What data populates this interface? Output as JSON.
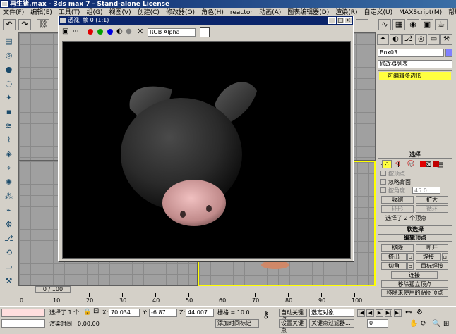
{
  "app": {
    "title": "再生猪.max - 3ds max 7 - Stand-alone License"
  },
  "menu": [
    "文件(F)",
    "编辑(E)",
    "工具(T)",
    "组(G)",
    "视图(V)",
    "创建(C)",
    "修改器(O)",
    "角色(H)",
    "reactor",
    "动画(A)",
    "图表编辑器(D)",
    "渲染(R)",
    "自定义(U)",
    "MAXScript(M)",
    "帮助(H)"
  ],
  "render_window": {
    "title": "透视, 帧 0 (1:1)",
    "channel": "RGB Alpha",
    "colors": {
      "red": "#e00000",
      "green": "#00a000",
      "blue": "#0000e0"
    }
  },
  "command_panel": {
    "object_name": "Box03",
    "modifier_list": "修改器列表",
    "stack_item": "可编辑多边形",
    "rollouts": {
      "selection": "选择",
      "by_vertex": "按顶点",
      "ignore_backfacing": "忽略背面",
      "by_angle": "按角度:",
      "angle_value": "45.0",
      "shrink": "收缩",
      "grow": "扩大",
      "ring": "环形",
      "loop": "循环",
      "selected_info": "选择了 2 个顶点",
      "soft_selection": "软选择",
      "edit_vertices": "编辑顶点",
      "remove": "移除",
      "break": "断开",
      "extrude": "挤出",
      "weld": "焊接",
      "chamfer": "切角",
      "target_weld": "目标焊接",
      "connect": "连接",
      "remove_isolated": "移除孤立顶点",
      "remove_unused": "移除未使用的贴图顶点"
    }
  },
  "timeline": {
    "frame": "0 / 100",
    "ticks": [
      "0",
      "10",
      "20",
      "30",
      "40",
      "50",
      "60",
      "70",
      "80",
      "90",
      "100"
    ]
  },
  "status": {
    "selected": "选择了 1 个",
    "x_label": "X:",
    "x_value": "70.034",
    "y_label": "Y:",
    "y_value": "-6.87",
    "z_label": "Z:",
    "z_value": "44.007",
    "grid": "栅格 = 10.0",
    "auto_key": "自动关键点",
    "selected_object": "选定对象",
    "set_key": "设置关键点",
    "key_filters": "关键点过滤器...",
    "render_time": "渲染时间",
    "render_time_value": "0:00:00",
    "add_time_tag": "添加时间标记",
    "frame_field": "0"
  }
}
